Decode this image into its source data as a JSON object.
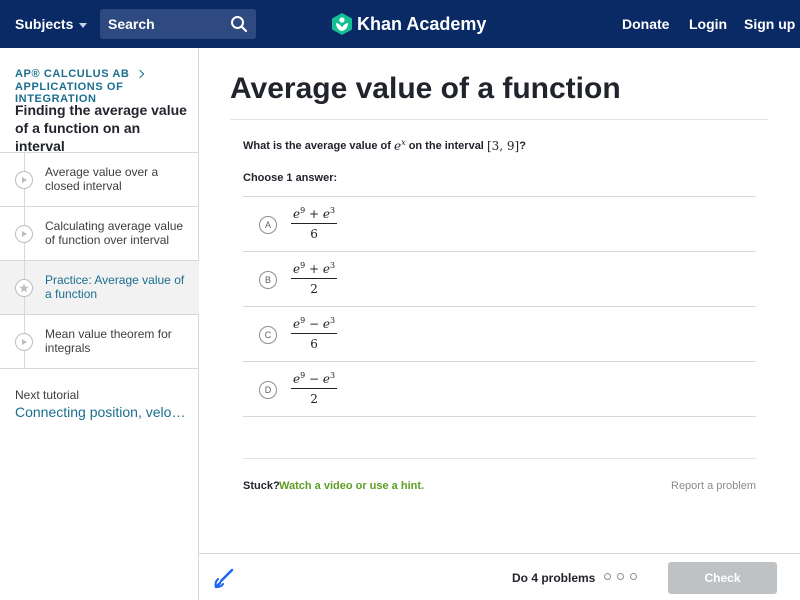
{
  "header": {
    "subjects_label": "Subjects",
    "search_placeholder": "Search",
    "brand_name": "Khan Academy",
    "donate_label": "Donate",
    "login_label": "Login",
    "signup_label": "Sign up"
  },
  "sidebar": {
    "course": "AP® Calculus AB",
    "unit": "Applications of integration",
    "tutorial_title": "Finding the average value of a function on an interval",
    "items": [
      {
        "label": "Average value over a closed interval",
        "icon": "play-icon"
      },
      {
        "label": "Calculating average value of function over interval",
        "icon": "play-icon"
      },
      {
        "label": "Practice: Average value of a function",
        "icon": "star-icon"
      },
      {
        "label": "Mean value theorem for integrals",
        "icon": "play-icon"
      }
    ],
    "next_label": "Next tutorial",
    "next_link": "Connecting position, velocity, and acceleration functions using integrals"
  },
  "main": {
    "title": "Average value of a function",
    "question": {
      "prefix": "What is the average value of",
      "func_base": "e",
      "func_exp": "x",
      "middle": "on the interval",
      "interval": "[3, 9]",
      "suffix": "?"
    },
    "choose_label": "Choose 1 answer:",
    "choices": [
      {
        "letter": "A",
        "num_a": "e",
        "exp_a": "9",
        "op": " + ",
        "num_b": "e",
        "exp_b": "3",
        "den": "6"
      },
      {
        "letter": "B",
        "num_a": "e",
        "exp_a": "9",
        "op": " + ",
        "num_b": "e",
        "exp_b": "3",
        "den": "2"
      },
      {
        "letter": "C",
        "num_a": "e",
        "exp_a": "9",
        "op": " − ",
        "num_b": "e",
        "exp_b": "3",
        "den": "6"
      },
      {
        "letter": "D",
        "num_a": "e",
        "exp_a": "9",
        "op": " − ",
        "num_b": "e",
        "exp_b": "3",
        "den": "2"
      }
    ],
    "stuck_label": "Stuck?",
    "hint_link": "Watch a video or use a hint.",
    "report_link": "Report a problem"
  },
  "footer": {
    "progress_label": "Do 4 problems",
    "problems_total": 4,
    "problems_done": 0,
    "check_label": "Check"
  },
  "colors": {
    "header_bg": "#0a2a66",
    "link_teal": "#1a6e8e",
    "hint_green": "#5e9e24",
    "check_disabled": "#bfc2c5"
  }
}
